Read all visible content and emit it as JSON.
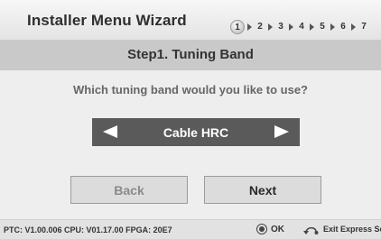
{
  "header": {
    "title": "Installer Menu Wizard",
    "steps": [
      "1",
      "2",
      "3",
      "4",
      "5",
      "6",
      "7"
    ],
    "active_step": "1"
  },
  "step": {
    "title": "Step1. Tuning Band"
  },
  "question": "Which tuning band would you like to use?",
  "selector": {
    "value": "Cable HRC",
    "left_icon": "triangle-left-icon",
    "right_icon": "triangle-right-icon"
  },
  "buttons": {
    "back_label": "Back",
    "next_label": "Next"
  },
  "footer": {
    "version": "PTC: V1.00.006 CPU: V01.17.00 FPGA: 20E7",
    "ok_label": "OK",
    "exit_label": "Exit Express Scrip",
    "ok_icon": "ok-button-icon",
    "back_icon": "return-arrow-icon"
  },
  "colors": {
    "selector_bg": "#5a5a5a",
    "step_band_bg": "#c9c9c9",
    "header_bg": "#eeeeee"
  }
}
